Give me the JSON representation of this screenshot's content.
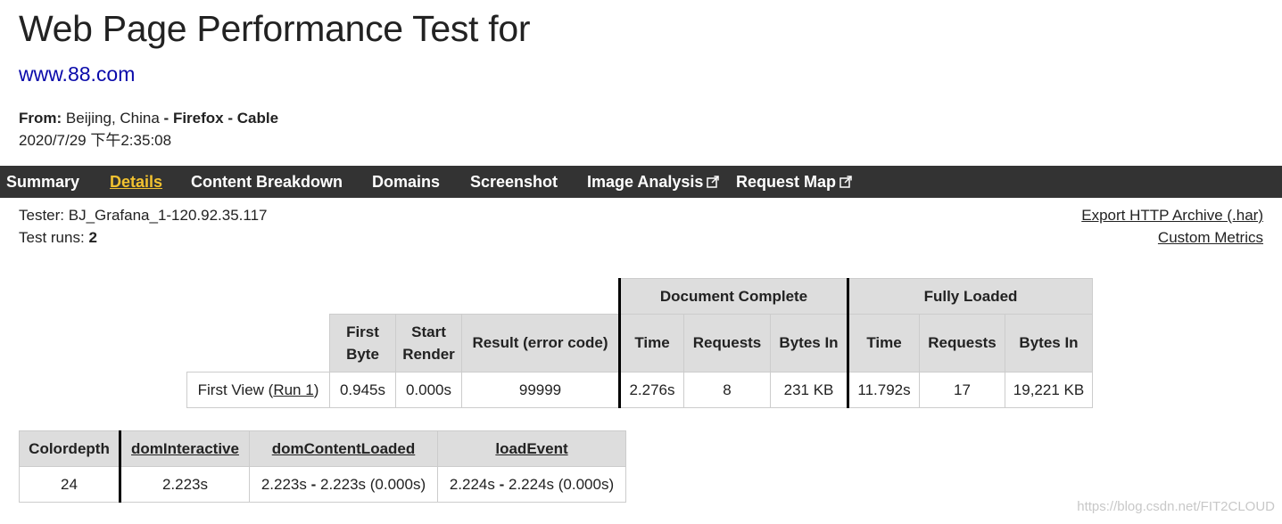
{
  "header": {
    "title": "Web Page Performance Test for",
    "url": "www.88.com",
    "from_label": "From:",
    "location": "Beijing, China",
    "separator": "-",
    "browser": "Firefox",
    "connection": "Cable",
    "datetime": "2020/7/29 下午2:35:08"
  },
  "nav": {
    "items": [
      "Summary",
      "Details",
      "Content Breakdown",
      "Domains",
      "Screenshot",
      "Image Analysis",
      "Request Map"
    ],
    "active": "Details",
    "active_color": "#f2c230",
    "background": "#333333"
  },
  "info": {
    "tester_label": "Tester:",
    "tester_value": "BJ_Grafana_1-120.92.35.117",
    "runs_label": "Test runs:",
    "runs_value": "2",
    "export_link": "Export HTTP Archive (.har)",
    "metrics_link": "Custom Metrics"
  },
  "results": {
    "group_headers": [
      "Document Complete",
      "Fully Loaded"
    ],
    "headers": {
      "first_byte_1": "First",
      "first_byte_2": "Byte",
      "start_render_1": "Start",
      "start_render_2": "Render",
      "result": "Result (error code)",
      "dc_time": "Time",
      "dc_requests": "Requests",
      "dc_bytes": "Bytes In",
      "fl_time": "Time",
      "fl_requests": "Requests",
      "fl_bytes": "Bytes In"
    },
    "row": {
      "label_prefix": "First View (",
      "run_link": "Run 1",
      "label_suffix": ")",
      "first_byte": "0.945s",
      "start_render": "0.000s",
      "result": "99999",
      "dc_time": "2.276s",
      "dc_requests": "8",
      "dc_bytes": "231 KB",
      "fl_time": "11.792s",
      "fl_requests": "17",
      "fl_bytes": "19,221 KB"
    }
  },
  "metrics": {
    "headers": {
      "colordepth": "Colordepth",
      "dom_interactive": "domInteractive",
      "dom_content_loaded": "domContentLoaded",
      "load_event": "loadEvent"
    },
    "row": {
      "colordepth": "24",
      "dom_interactive": "2.223s",
      "dcl_start": "2.223s",
      "dcl_sep": " - ",
      "dcl_end": "2.223s (0.000s)",
      "le_start": "2.224s",
      "le_sep": " - ",
      "le_end": "2.224s (0.000s)"
    }
  },
  "watermark": "https://blog.csdn.net/FIT2CLOUD"
}
